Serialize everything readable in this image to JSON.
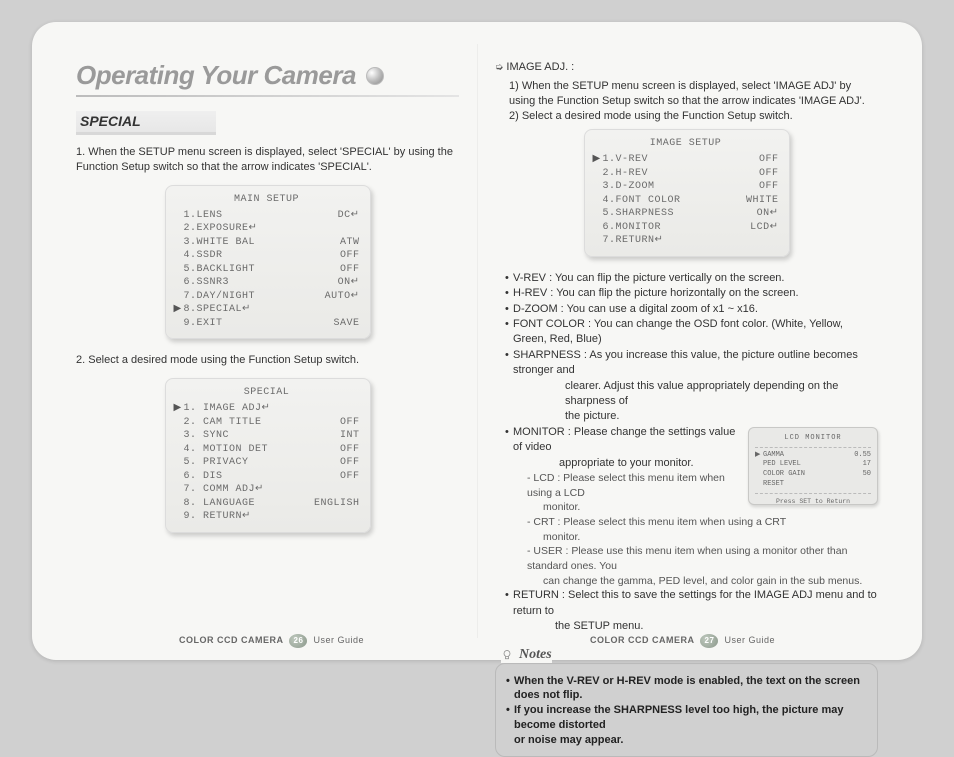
{
  "chapter_title": "Operating Your Camera",
  "left": {
    "section": "SPECIAL",
    "step1": "1. When the SETUP menu screen is displayed, select 'SPECIAL' by using the Function Setup switch so that the arrow indicates 'SPECIAL'.",
    "step2": "2. Select a desired mode using the Function Setup switch.",
    "osd1": {
      "title": "MAIN SETUP",
      "rows": [
        {
          "arrow": "",
          "label": "1.LENS",
          "val": "DC↵"
        },
        {
          "arrow": "",
          "label": "2.EXPOSURE↵",
          "val": ""
        },
        {
          "arrow": "",
          "label": "3.WHITE BAL",
          "val": "ATW"
        },
        {
          "arrow": "",
          "label": "4.SSDR",
          "val": "OFF"
        },
        {
          "arrow": "",
          "label": "5.BACKLIGHT",
          "val": "OFF"
        },
        {
          "arrow": "",
          "label": "6.SSNR3",
          "val": "ON↵"
        },
        {
          "arrow": "",
          "label": "7.DAY/NIGHT",
          "val": "AUTO↵"
        },
        {
          "arrow": "▶",
          "label": "8.SPECIAL↵",
          "val": ""
        },
        {
          "arrow": "",
          "label": "9.EXIT",
          "val": "SAVE"
        }
      ]
    },
    "osd2": {
      "title": "SPECIAL",
      "rows": [
        {
          "arrow": "▶",
          "label": "1. IMAGE ADJ↵",
          "val": ""
        },
        {
          "arrow": "",
          "label": "2. CAM TITLE",
          "val": "OFF"
        },
        {
          "arrow": "",
          "label": "3. SYNC",
          "val": "INT"
        },
        {
          "arrow": "",
          "label": "4. MOTION DET",
          "val": "OFF"
        },
        {
          "arrow": "",
          "label": "5. PRIVACY",
          "val": "OFF"
        },
        {
          "arrow": "",
          "label": "6. DIS",
          "val": "OFF"
        },
        {
          "arrow": "",
          "label": "7. COMM ADJ↵",
          "val": ""
        },
        {
          "arrow": "",
          "label": "8. LANGUAGE",
          "val": "ENGLISH"
        },
        {
          "arrow": "",
          "label": "9. RETURN↵",
          "val": ""
        }
      ]
    }
  },
  "right": {
    "head_symbol": "➭",
    "head_label": "IMAGE ADJ. :",
    "step1": "1) When the SETUP menu screen is displayed, select 'IMAGE ADJ' by using the Function Setup switch so that the arrow indicates 'IMAGE ADJ'.",
    "step2": "2) Select a desired mode using the Function Setup switch.",
    "osd3": {
      "title": "IMAGE SETUP",
      "rows": [
        {
          "arrow": "▶",
          "label": "1.V-REV",
          "val": "OFF"
        },
        {
          "arrow": "",
          "label": "2.H-REV",
          "val": "OFF"
        },
        {
          "arrow": "",
          "label": "3.D-ZOOM",
          "val": "OFF"
        },
        {
          "arrow": "",
          "label": "4.FONT COLOR",
          "val": "WHITE"
        },
        {
          "arrow": "",
          "label": "5.SHARPNESS",
          "val": "ON↵"
        },
        {
          "arrow": "",
          "label": "6.MONITOR",
          "val": "LCD↵"
        },
        {
          "arrow": "",
          "label": "7.RETURN↵",
          "val": ""
        }
      ]
    },
    "bul": {
      "vrev": "V-REV : You can flip the picture vertically on the screen.",
      "hrev": "H-REV : You can flip the picture horizontally on the screen.",
      "dzoom": "D-ZOOM : You can use a digital zoom of x1 ~ x16.",
      "font": "FONT COLOR : You can change the OSD font color. (White, Yellow, Green, Red, Blue)",
      "sharp1": "SHARPNESS : As you increase this value, the picture outline becomes stronger and",
      "sharp2": "clearer. Adjust this value appropriately depending on the sharpness of",
      "sharp3": "the picture.",
      "mon1": "MONITOR : Please change the settings value of video",
      "mon2": "appropriate to your monitor.",
      "lcd1": "- LCD : Please select this menu item when using a LCD",
      "lcd2": "monitor.",
      "crt1": "- CRT : Please select this menu item when using a CRT",
      "crt2": "monitor.",
      "user1": "- USER : Please use this menu item when using a monitor other than standard ones. You",
      "user2": "can change the gamma, PED level, and color gain in the sub menus.",
      "ret1": "RETURN : Select this to save the settings for the IMAGE ADJ menu and to return to",
      "ret2": "the SETUP menu."
    },
    "lcd": {
      "title": "LCD MONITOR",
      "rows": [
        {
          "arrow": "▶",
          "label": "GAMMA",
          "val": "0.55"
        },
        {
          "arrow": "",
          "label": "PED LEVEL",
          "val": "17"
        },
        {
          "arrow": "",
          "label": "COLOR GAIN",
          "val": "50"
        },
        {
          "arrow": "",
          "label": "RESET",
          "val": ""
        }
      ],
      "press": "Press SET to Return"
    },
    "notes_label": "Notes",
    "note1": "When the V-REV or H-REV mode is enabled, the text on the screen does not flip.",
    "note2a": "If you increase the SHARPNESS level too high, the picture may become distorted",
    "note2b": "or noise may appear."
  },
  "footer": {
    "product": "COLOR CCD CAMERA",
    "guide": "User Guide",
    "page_left": "26",
    "page_right": "27"
  }
}
